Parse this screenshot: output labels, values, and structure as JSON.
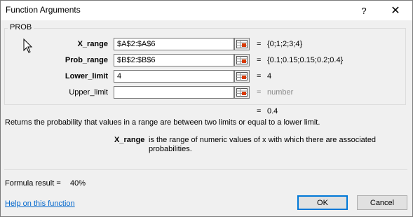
{
  "window": {
    "title": "Function Arguments",
    "help_symbol": "?",
    "close_symbol": "✕"
  },
  "function_name": "PROB",
  "arguments": [
    {
      "label": "X_range",
      "value": "$A$2:$A$6",
      "eq": "=",
      "result": "{0;1;2;3;4}",
      "bold": true
    },
    {
      "label": "Prob_range",
      "value": "$B$2:$B$6",
      "eq": "=",
      "result": "{0.1;0.15;0.15;0.2;0.4}",
      "bold": true
    },
    {
      "label": "Lower_limit",
      "value": "4",
      "eq": "=",
      "result": "4",
      "bold": true
    },
    {
      "label": "Upper_limit",
      "value": "",
      "eq": "=",
      "result": "number",
      "bold": false
    }
  ],
  "result": {
    "eq": "=",
    "value": "0.4"
  },
  "description": "Returns the probability that values in a range are between two limits or equal to a lower limit.",
  "argument_help": {
    "name": "X_range",
    "text": "is the range of numeric values of x with which there are associated probabilities."
  },
  "formula_result": {
    "label": "Formula result =",
    "value": "40%"
  },
  "help_link": "Help on this function",
  "buttons": {
    "ok": "OK",
    "cancel": "Cancel"
  },
  "icons": {
    "ref": "range-select-icon",
    "cursor": "mouse-pointer-icon"
  }
}
